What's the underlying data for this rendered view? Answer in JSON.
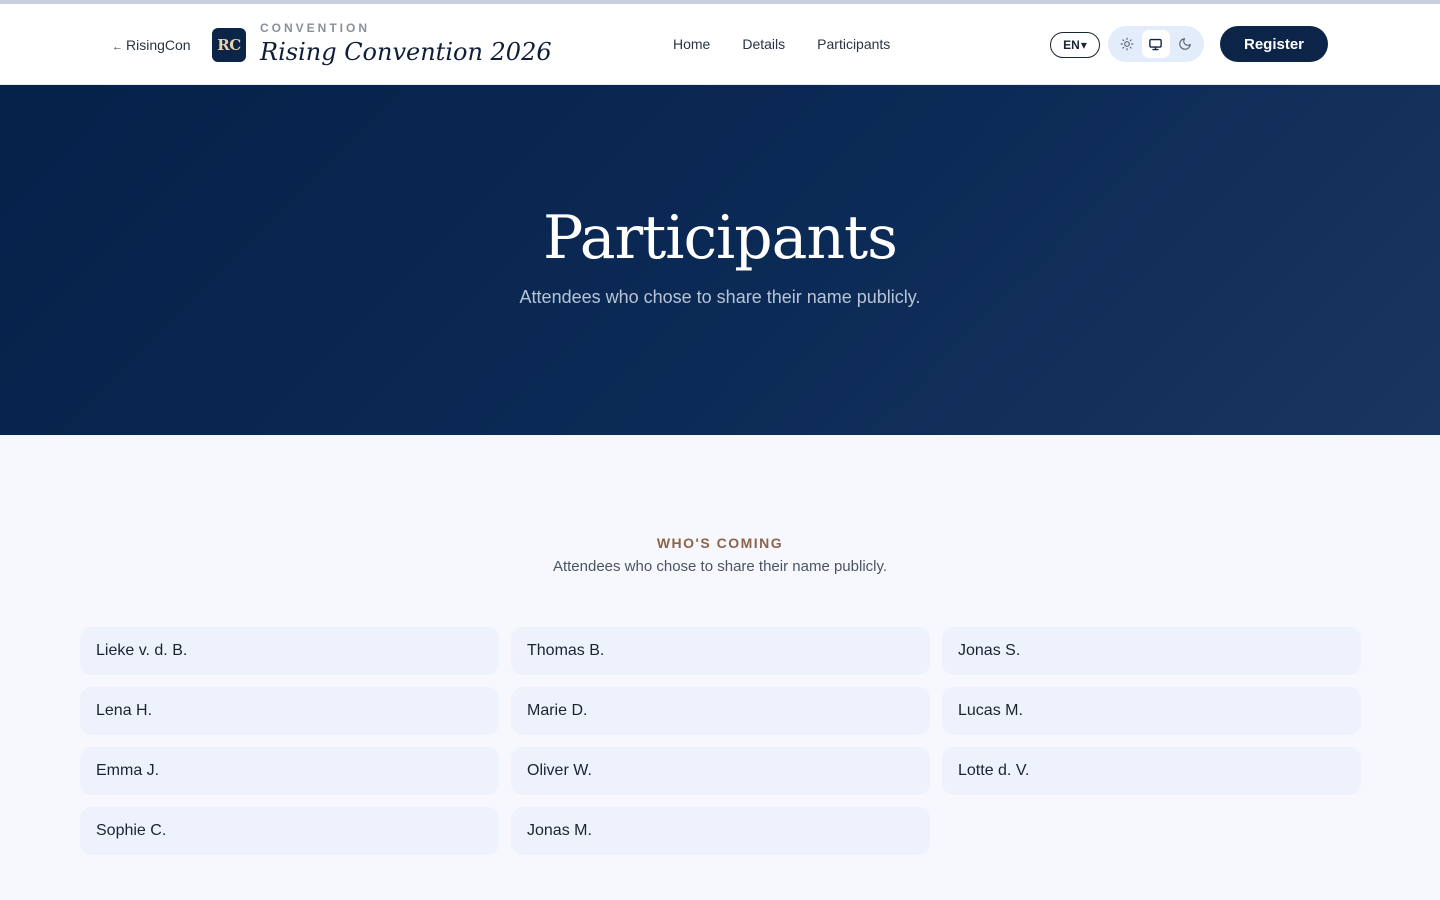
{
  "header": {
    "back_arrow": "←",
    "back_label": "RisingCon",
    "logo_text": "RC",
    "kicker": "CONVENTION",
    "title": "Rising Convention 2026",
    "nav": [
      "Home",
      "Details",
      "Participants"
    ],
    "language": "EN",
    "language_caret": "▾",
    "theme_options": [
      "light",
      "system",
      "dark"
    ],
    "theme_selected": "system",
    "register_label": "Register"
  },
  "hero": {
    "title": "Participants",
    "subtitle": "Attendees who chose to share their name publicly."
  },
  "section": {
    "kicker": "WHO'S COMING",
    "subtitle": "Attendees who chose to share their name publicly."
  },
  "participants": [
    "Lieke v. d. B.",
    "Thomas B.",
    "Jonas S.",
    "Lena H.",
    "Marie D.",
    "Lucas M.",
    "Emma J.",
    "Oliver W.",
    "Lotte d. V.",
    "Sophie C.",
    "Jonas M."
  ],
  "colors": {
    "brand_navy": "#0c2448",
    "accent_brown": "#8c6449",
    "card_bg": "#edf2fc"
  },
  "icons": [
    "sun-icon",
    "monitor-icon",
    "moon-icon"
  ]
}
